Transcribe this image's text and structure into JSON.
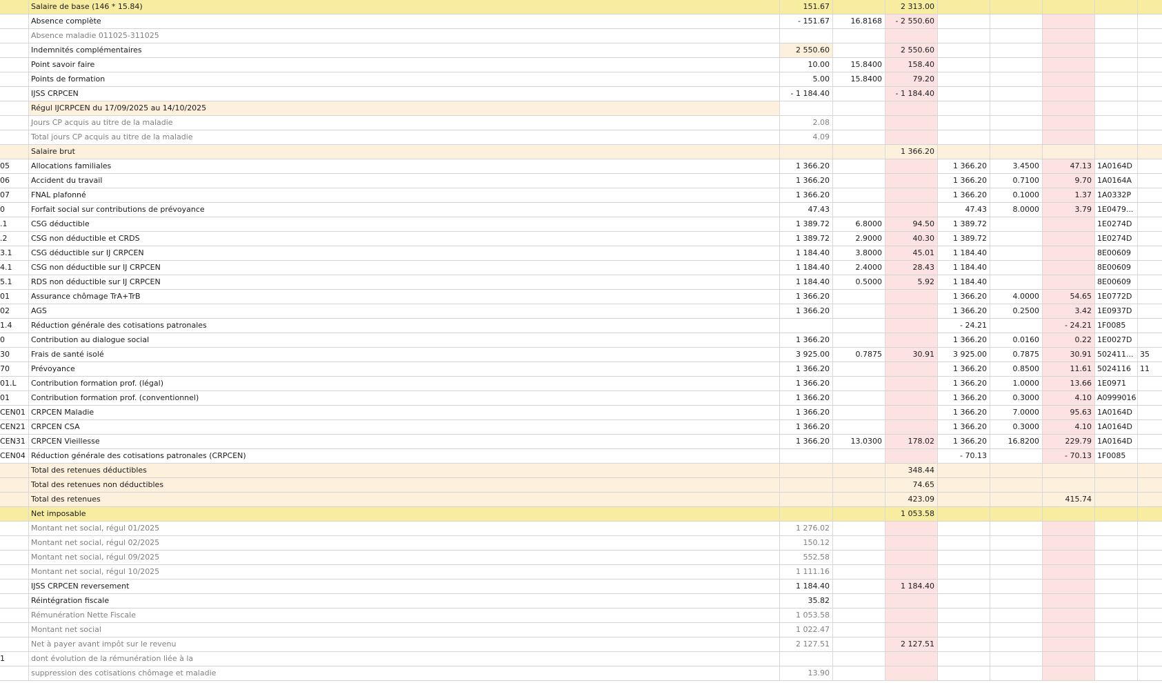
{
  "payslip": {
    "rows": [
      {
        "code": "",
        "label": "Salaire de base (146 * 15.84)",
        "b1": "151.67",
        "t1": "",
        "g1": "2 313.00",
        "b2": "",
        "t2": "",
        "m2": "",
        "ref": "",
        "ex": "",
        "style": "yellow"
      },
      {
        "code": "",
        "label": "Absence complète",
        "b1": "- 151.67",
        "t1": "16.8168",
        "g1": "- 2 550.60",
        "b2": "",
        "t2": "",
        "m2": "",
        "ref": "",
        "ex": "",
        "style": ""
      },
      {
        "code": "",
        "label": "Absence maladie 011025-311025",
        "b1": "",
        "t1": "",
        "g1": "",
        "b2": "",
        "t2": "",
        "m2": "",
        "ref": "",
        "ex": "",
        "style": "gray"
      },
      {
        "code": "",
        "label": "Indemnités complémentaires",
        "b1": "2 550.60",
        "t1": "",
        "g1": "2 550.60",
        "b2": "",
        "t2": "",
        "m2": "",
        "ref": "",
        "ex": "",
        "style": "",
        "b1cream": true
      },
      {
        "code": "",
        "label": "Point savoir faire",
        "b1": "10.00",
        "t1": "15.8400",
        "g1": "158.40",
        "b2": "",
        "t2": "",
        "m2": "",
        "ref": "",
        "ex": "",
        "style": ""
      },
      {
        "code": "",
        "label": "Points de formation",
        "b1": "5.00",
        "t1": "15.8400",
        "g1": "79.20",
        "b2": "",
        "t2": "",
        "m2": "",
        "ref": "",
        "ex": "",
        "style": ""
      },
      {
        "code": "",
        "label": "IJSS CRPCEN",
        "b1": "- 1 184.40",
        "t1": "",
        "g1": "- 1 184.40",
        "b2": "",
        "t2": "",
        "m2": "",
        "ref": "",
        "ex": "",
        "style": ""
      },
      {
        "code": "",
        "label": "Régul IJCRPCEN du 17/09/2025 au 14/10/2025",
        "b1": "",
        "t1": "",
        "g1": "",
        "b2": "",
        "t2": "",
        "m2": "",
        "ref": "",
        "ex": "",
        "style": "",
        "lblcream": true
      },
      {
        "code": "",
        "label": "Jours CP acquis au titre de la maladie",
        "b1": "2.08",
        "t1": "",
        "g1": "",
        "b2": "",
        "t2": "",
        "m2": "",
        "ref": "",
        "ex": "",
        "style": "gray"
      },
      {
        "code": "",
        "label": "Total jours CP acquis au titre de la maladie",
        "b1": "4.09",
        "t1": "",
        "g1": "",
        "b2": "",
        "t2": "",
        "m2": "",
        "ref": "",
        "ex": "",
        "style": "gray"
      },
      {
        "code": "",
        "label": "Salaire brut",
        "b1": "",
        "t1": "",
        "g1": "1 366.20",
        "b2": "",
        "t2": "",
        "m2": "",
        "ref": "",
        "ex": "",
        "style": "cream"
      },
      {
        "code": "05",
        "label": "Allocations familiales",
        "b1": "1 366.20",
        "t1": "",
        "g1": "",
        "b2": "1 366.20",
        "t2": "3.4500",
        "m2": "47.13",
        "ref": "1A0164D",
        "ex": "",
        "style": ""
      },
      {
        "code": "06",
        "label": "Accident du travail",
        "b1": "1 366.20",
        "t1": "",
        "g1": "",
        "b2": "1 366.20",
        "t2": "0.7100",
        "m2": "9.70",
        "ref": "1A0164A",
        "ex": "",
        "style": ""
      },
      {
        "code": "07",
        "label": "FNAL plafonné",
        "b1": "1 366.20",
        "t1": "",
        "g1": "",
        "b2": "1 366.20",
        "t2": "0.1000",
        "m2": "1.37",
        "ref": "1A0332P",
        "ex": "",
        "style": ""
      },
      {
        "code": "0",
        "label": "Forfait social sur contributions de prévoyance",
        "b1": "47.43",
        "t1": "",
        "g1": "",
        "b2": "47.43",
        "t2": "8.0000",
        "m2": "3.79",
        "ref": "1E0479...",
        "ex": "",
        "style": ""
      },
      {
        "code": ".1",
        "label": "CSG déductible",
        "b1": "1 389.72",
        "t1": "6.8000",
        "g1": "94.50",
        "b2": "1 389.72",
        "t2": "",
        "m2": "",
        "ref": "1E0274D",
        "ex": "",
        "style": ""
      },
      {
        "code": ".2",
        "label": "CSG non déductible et CRDS",
        "b1": "1 389.72",
        "t1": "2.9000",
        "g1": "40.30",
        "b2": "1 389.72",
        "t2": "",
        "m2": "",
        "ref": "1E0274D",
        "ex": "",
        "style": ""
      },
      {
        "code": "3.1",
        "label": "CSG déductible sur IJ CRPCEN",
        "b1": "1 184.40",
        "t1": "3.8000",
        "g1": "45.01",
        "b2": "1 184.40",
        "t2": "",
        "m2": "",
        "ref": "8E00609",
        "ex": "",
        "style": ""
      },
      {
        "code": "4.1",
        "label": "CSG non déductible sur IJ CRPCEN",
        "b1": "1 184.40",
        "t1": "2.4000",
        "g1": "28.43",
        "b2": "1 184.40",
        "t2": "",
        "m2": "",
        "ref": "8E00609",
        "ex": "",
        "style": ""
      },
      {
        "code": "5.1",
        "label": "RDS non déductible sur IJ CRPCEN",
        "b1": "1 184.40",
        "t1": "0.5000",
        "g1": "5.92",
        "b2": "1 184.40",
        "t2": "",
        "m2": "",
        "ref": "8E00609",
        "ex": "",
        "style": ""
      },
      {
        "code": "01",
        "label": "Assurance chômage TrA+TrB",
        "b1": "1 366.20",
        "t1": "",
        "g1": "",
        "b2": "1 366.20",
        "t2": "4.0000",
        "m2": "54.65",
        "ref": "1E0772D",
        "ex": "",
        "style": ""
      },
      {
        "code": "02",
        "label": "AGS",
        "b1": "1 366.20",
        "t1": "",
        "g1": "",
        "b2": "1 366.20",
        "t2": "0.2500",
        "m2": "3.42",
        "ref": "1E0937D",
        "ex": "",
        "style": ""
      },
      {
        "code": "1.4",
        "label": "Réduction générale des cotisations patronales",
        "b1": "",
        "t1": "",
        "g1": "",
        "b2": "- 24.21",
        "t2": "",
        "m2": "- 24.21",
        "ref": "1F0085",
        "ex": "",
        "style": ""
      },
      {
        "code": "0",
        "label": "Contribution au dialogue social",
        "b1": "1 366.20",
        "t1": "",
        "g1": "",
        "b2": "1 366.20",
        "t2": "0.0160",
        "m2": "0.22",
        "ref": "1E0027D",
        "ex": "",
        "style": ""
      },
      {
        "code": "30",
        "label": "Frais de santé isolé",
        "b1": "3 925.00",
        "t1": "0.7875",
        "g1": "30.91",
        "b2": "3 925.00",
        "t2": "0.7875",
        "m2": "30.91",
        "ref": "502411...",
        "ex": "35",
        "style": ""
      },
      {
        "code": "70",
        "label": "Prévoyance",
        "b1": "1 366.20",
        "t1": "",
        "g1": "",
        "b2": "1 366.20",
        "t2": "0.8500",
        "m2": "11.61",
        "ref": "5024116",
        "ex": "11",
        "style": ""
      },
      {
        "code": "01.L",
        "label": "Contribution formation prof. (légal)",
        "b1": "1 366.20",
        "t1": "",
        "g1": "",
        "b2": "1 366.20",
        "t2": "1.0000",
        "m2": "13.66",
        "ref": "1E0971",
        "ex": "",
        "style": ""
      },
      {
        "code": "01",
        "label": "Contribution formation prof. (conventionnel)",
        "b1": "1 366.20",
        "t1": "",
        "g1": "",
        "b2": "1 366.20",
        "t2": "0.3000",
        "m2": "4.10",
        "ref": "A0999016",
        "ex": "",
        "style": ""
      },
      {
        "code": "CEN01",
        "label": "CRPCEN Maladie",
        "b1": "1 366.20",
        "t1": "",
        "g1": "",
        "b2": "1 366.20",
        "t2": "7.0000",
        "m2": "95.63",
        "ref": "1A0164D",
        "ex": "",
        "style": ""
      },
      {
        "code": "CEN21",
        "label": "CRPCEN CSA",
        "b1": "1 366.20",
        "t1": "",
        "g1": "",
        "b2": "1 366.20",
        "t2": "0.3000",
        "m2": "4.10",
        "ref": "1A0164D",
        "ex": "",
        "style": ""
      },
      {
        "code": "CEN31",
        "label": "CRPCEN Vieillesse",
        "b1": "1 366.20",
        "t1": "13.0300",
        "g1": "178.02",
        "b2": "1 366.20",
        "t2": "16.8200",
        "m2": "229.79",
        "ref": "1A0164D",
        "ex": "",
        "style": ""
      },
      {
        "code": "CEN04",
        "label": "Réduction générale des cotisations patronales (CRPCEN)",
        "b1": "",
        "t1": "",
        "g1": "",
        "b2": "- 70.13",
        "t2": "",
        "m2": "- 70.13",
        "ref": "1F0085",
        "ex": "",
        "style": ""
      },
      {
        "code": "",
        "label": "Total des retenues déductibles",
        "b1": "",
        "t1": "",
        "g1": "348.44",
        "b2": "",
        "t2": "",
        "m2": "",
        "ref": "",
        "ex": "",
        "style": "cream"
      },
      {
        "code": "",
        "label": "Total des retenues non déductibles",
        "b1": "",
        "t1": "",
        "g1": "74.65",
        "b2": "",
        "t2": "",
        "m2": "",
        "ref": "",
        "ex": "",
        "style": "cream"
      },
      {
        "code": "",
        "label": "Total des retenues",
        "b1": "",
        "t1": "",
        "g1": "423.09",
        "b2": "",
        "t2": "",
        "m2": "415.74",
        "ref": "",
        "ex": "",
        "style": "cream"
      },
      {
        "code": "",
        "label": "Net imposable",
        "b1": "",
        "t1": "",
        "g1": "1 053.58",
        "b2": "",
        "t2": "",
        "m2": "",
        "ref": "",
        "ex": "",
        "style": "yellow"
      },
      {
        "code": "",
        "label": "Montant net social, régul 01/2025",
        "b1": "1 276.02",
        "t1": "",
        "g1": "",
        "b2": "",
        "t2": "",
        "m2": "",
        "ref": "",
        "ex": "",
        "style": "gray"
      },
      {
        "code": "",
        "label": "Montant net social, régul 02/2025",
        "b1": "150.12",
        "t1": "",
        "g1": "",
        "b2": "",
        "t2": "",
        "m2": "",
        "ref": "",
        "ex": "",
        "style": "gray"
      },
      {
        "code": "",
        "label": "Montant net social, régul 09/2025",
        "b1": "552.58",
        "t1": "",
        "g1": "",
        "b2": "",
        "t2": "",
        "m2": "",
        "ref": "",
        "ex": "",
        "style": "gray"
      },
      {
        "code": "",
        "label": "Montant net social, régul 10/2025",
        "b1": "1 111.16",
        "t1": "",
        "g1": "",
        "b2": "",
        "t2": "",
        "m2": "",
        "ref": "",
        "ex": "",
        "style": "gray"
      },
      {
        "code": "",
        "label": "IJSS CRPCEN reversement",
        "b1": "1 184.40",
        "t1": "",
        "g1": "1 184.40",
        "b2": "",
        "t2": "",
        "m2": "",
        "ref": "",
        "ex": "",
        "style": ""
      },
      {
        "code": "",
        "label": "Réintégration fiscale",
        "b1": "35.82",
        "t1": "",
        "g1": "",
        "b2": "",
        "t2": "",
        "m2": "",
        "ref": "",
        "ex": "",
        "style": ""
      },
      {
        "code": "",
        "label": "Rémunération Nette Fiscale",
        "b1": "1 053.58",
        "t1": "",
        "g1": "",
        "b2": "",
        "t2": "",
        "m2": "",
        "ref": "",
        "ex": "",
        "style": "gray"
      },
      {
        "code": "",
        "label": "Montant net social",
        "b1": "1 022.47",
        "t1": "",
        "g1": "",
        "b2": "",
        "t2": "",
        "m2": "",
        "ref": "",
        "ex": "",
        "style": "gray"
      },
      {
        "code": "",
        "label": "Net à payer avant impôt sur le revenu",
        "b1": "2 127.51",
        "t1": "",
        "g1": "2 127.51",
        "b2": "",
        "t2": "",
        "m2": "",
        "ref": "",
        "ex": "",
        "style": "gray"
      },
      {
        "code": "1",
        "label": "dont évolution de la rémunération liée à la",
        "b1": "",
        "t1": "",
        "g1": "",
        "b2": "",
        "t2": "",
        "m2": "",
        "ref": "",
        "ex": "",
        "style": "gray"
      },
      {
        "code": "",
        "label": "suppression des cotisations chômage et maladie",
        "b1": "13.90",
        "t1": "",
        "g1": "",
        "b2": "",
        "t2": "",
        "m2": "",
        "ref": "",
        "ex": "",
        "style": "gray"
      }
    ]
  }
}
